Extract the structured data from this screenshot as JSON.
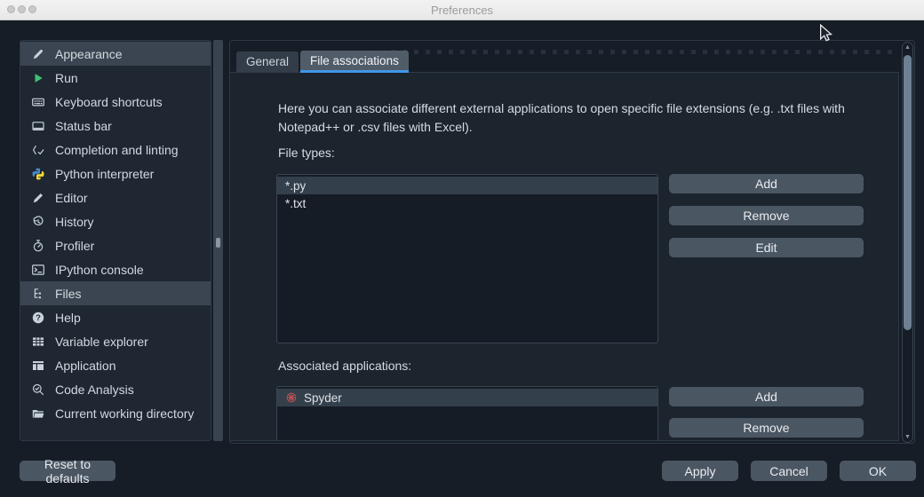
{
  "window": {
    "title": "Preferences"
  },
  "sidebar": {
    "items": [
      {
        "label": "Appearance",
        "icon": "appearance-icon",
        "selected": true
      },
      {
        "label": "Run",
        "icon": "run-icon",
        "selected": false
      },
      {
        "label": "Keyboard shortcuts",
        "icon": "keyboard-icon",
        "selected": false
      },
      {
        "label": "Status bar",
        "icon": "statusbar-icon",
        "selected": false
      },
      {
        "label": "Completion and linting",
        "icon": "completion-icon",
        "selected": false
      },
      {
        "label": "Python interpreter",
        "icon": "python-icon",
        "selected": false
      },
      {
        "label": "Editor",
        "icon": "editor-icon",
        "selected": false
      },
      {
        "label": "History",
        "icon": "history-icon",
        "selected": false
      },
      {
        "label": "Profiler",
        "icon": "profiler-icon",
        "selected": false
      },
      {
        "label": "IPython console",
        "icon": "ipython-console-icon",
        "selected": false
      },
      {
        "label": "Files",
        "icon": "files-icon",
        "selected": true
      },
      {
        "label": "Help",
        "icon": "help-icon",
        "selected": false
      },
      {
        "label": "Variable explorer",
        "icon": "variable-explorer-icon",
        "selected": false
      },
      {
        "label": "Application",
        "icon": "application-icon",
        "selected": false
      },
      {
        "label": "Code Analysis",
        "icon": "code-analysis-icon",
        "selected": false
      },
      {
        "label": "Current working directory",
        "icon": "folder-icon",
        "selected": false
      }
    ]
  },
  "tabs": [
    {
      "label": "General",
      "active": false
    },
    {
      "label": "File associations",
      "active": true
    }
  ],
  "content": {
    "description": "Here you can associate different external applications to open specific file extensions (e.g. .txt files with Notepad++ or .csv files with Excel).",
    "file_types_label": "File types:",
    "file_types": [
      {
        "name": "*.py",
        "selected": true
      },
      {
        "name": "*.txt",
        "selected": false
      }
    ],
    "file_type_buttons": [
      "Add",
      "Remove",
      "Edit"
    ],
    "associated_apps_label": "Associated applications:",
    "associated_apps": [
      {
        "name": "Spyder",
        "icon": "spyder-icon",
        "selected": true
      }
    ],
    "app_buttons": [
      "Add",
      "Remove"
    ]
  },
  "footer": {
    "reset": "Reset to defaults",
    "apply": "Apply",
    "cancel": "Cancel",
    "ok": "OK"
  },
  "colors": {
    "accent": "#3f97e8",
    "selection": "#3b4552",
    "button": "#4b5663",
    "window_bg": "#161d26",
    "panel_bg": "#1c242e",
    "titlebar_bg": "#ededed",
    "run_green": "#3fc171",
    "spyder_red": "#cf5050"
  }
}
